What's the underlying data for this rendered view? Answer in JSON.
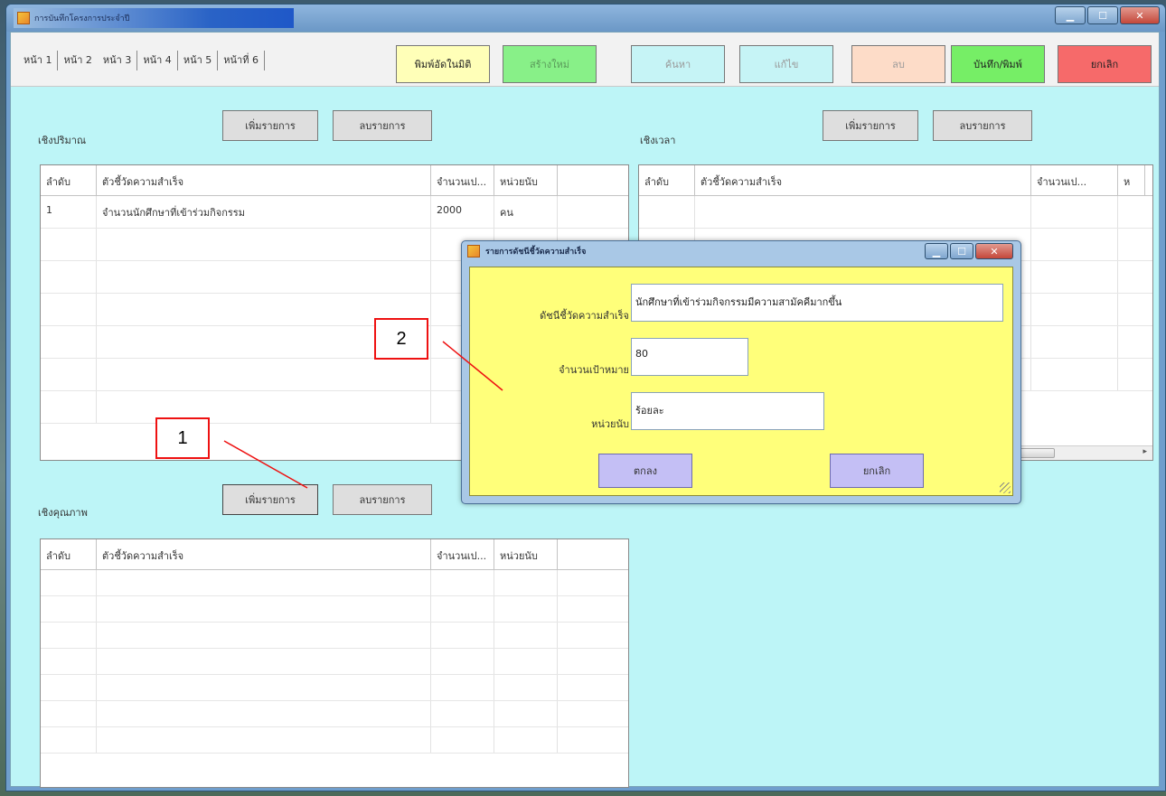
{
  "window": {
    "title": "การบันทึกโครงการประจำปี"
  },
  "tabs": [
    "หน้า 1",
    "หน้า 2",
    "หน้า 3",
    "หน้า 4",
    "หน้า 5",
    "หน้าที่ 6"
  ],
  "toolbar": {
    "print_draft": "พิมพ์อัดในมิติ",
    "new": "สร้างใหม่",
    "search": "ค้นหา",
    "edit": "แก้ไข",
    "delete": "ลบ",
    "save_print": "บันทึก/พิมพ์",
    "cancel": "ยกเลิก"
  },
  "colors": {
    "print_draft": "#ffffb8",
    "new": "#88f088",
    "search": "#c6f4f6",
    "edit": "#c6f4f6",
    "delete": "#fddcc8",
    "save_print": "#76ee66",
    "cancel": "#f66a6a"
  },
  "quantity": {
    "label": "เชิงปริมาณ",
    "add_label": "เพิ่มรายการ",
    "remove_label": "ลบรายการ",
    "columns": [
      "ลำดับ",
      "ตัวชี้วัดความสำเร็จ",
      "จำนวนเป...",
      "หน่วยนับ"
    ],
    "rows": [
      [
        "1",
        "จำนวนนักศึกษาที่เข้าร่วมกิจกรรม",
        "2000",
        "คน"
      ]
    ]
  },
  "time": {
    "label": "เชิงเวลา",
    "add_label": "เพิ่มรายการ",
    "remove_label": "ลบรายการ",
    "columns": [
      "ลำดับ",
      "ตัวชี้วัดความสำเร็จ",
      "จำนวนเป...",
      "ห"
    ]
  },
  "quality": {
    "label": "เชิงคุณภาพ",
    "add_label": "เพิ่มรายการ",
    "remove_label": "ลบรายการ",
    "columns": [
      "ลำดับ",
      "ตัวชี้วัดความสำเร็จ",
      "จำนวนเป...",
      "หน่วยนับ"
    ]
  },
  "dialog": {
    "title": "รายการดัชนีชี้วัดความสำเร็จ",
    "indicator_label": "ดัชนีชี้วัดความสำเร็จ",
    "indicator_value": "นักศึกษาที่เข้าร่วมกิจกรรมมีความสามัคคีมากขึ้น",
    "target_label": "จำนวนเป้าหมาย",
    "target_value": "80",
    "unit_label": "หน่วยนับ",
    "unit_value": "ร้อยละ",
    "ok_label": "ตกลง",
    "cancel_label": "ยกเลิก"
  },
  "annotations": [
    "1",
    "2"
  ]
}
